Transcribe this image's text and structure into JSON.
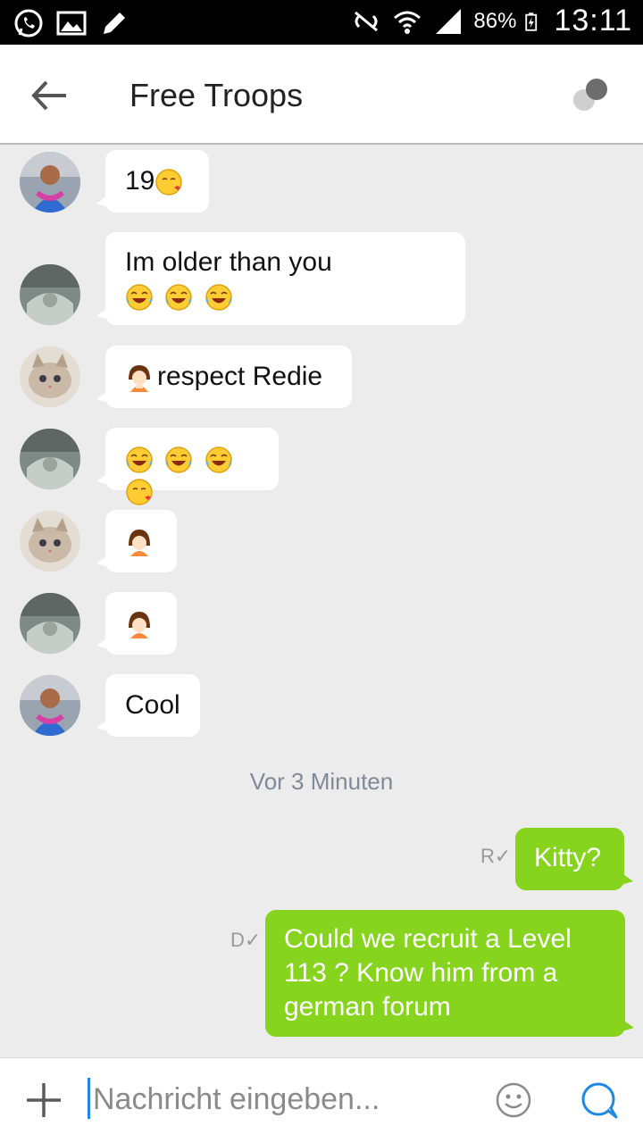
{
  "status_bar": {
    "battery": "86%",
    "time": "13:11"
  },
  "header": {
    "title": "Free Troops"
  },
  "messages": [
    {
      "text": "19"
    },
    {
      "text": "Im older than you"
    },
    {
      "text": "respect Redie"
    },
    {
      "text": ""
    },
    {
      "text": ""
    },
    {
      "text": ""
    },
    {
      "text": "Cool"
    }
  ],
  "timestamp": "Vor 3 Minuten",
  "outgoing": [
    {
      "text": "Kitty?",
      "receipt": "R"
    },
    {
      "text": "Could we recruit a Level 113 ? Know him from a german forum",
      "receipt": "D"
    }
  ],
  "composer": {
    "placeholder": "Nachricht eingeben..."
  },
  "colors": {
    "outgoing_bubble": "#86d41d",
    "accent": "#1e88e5"
  }
}
